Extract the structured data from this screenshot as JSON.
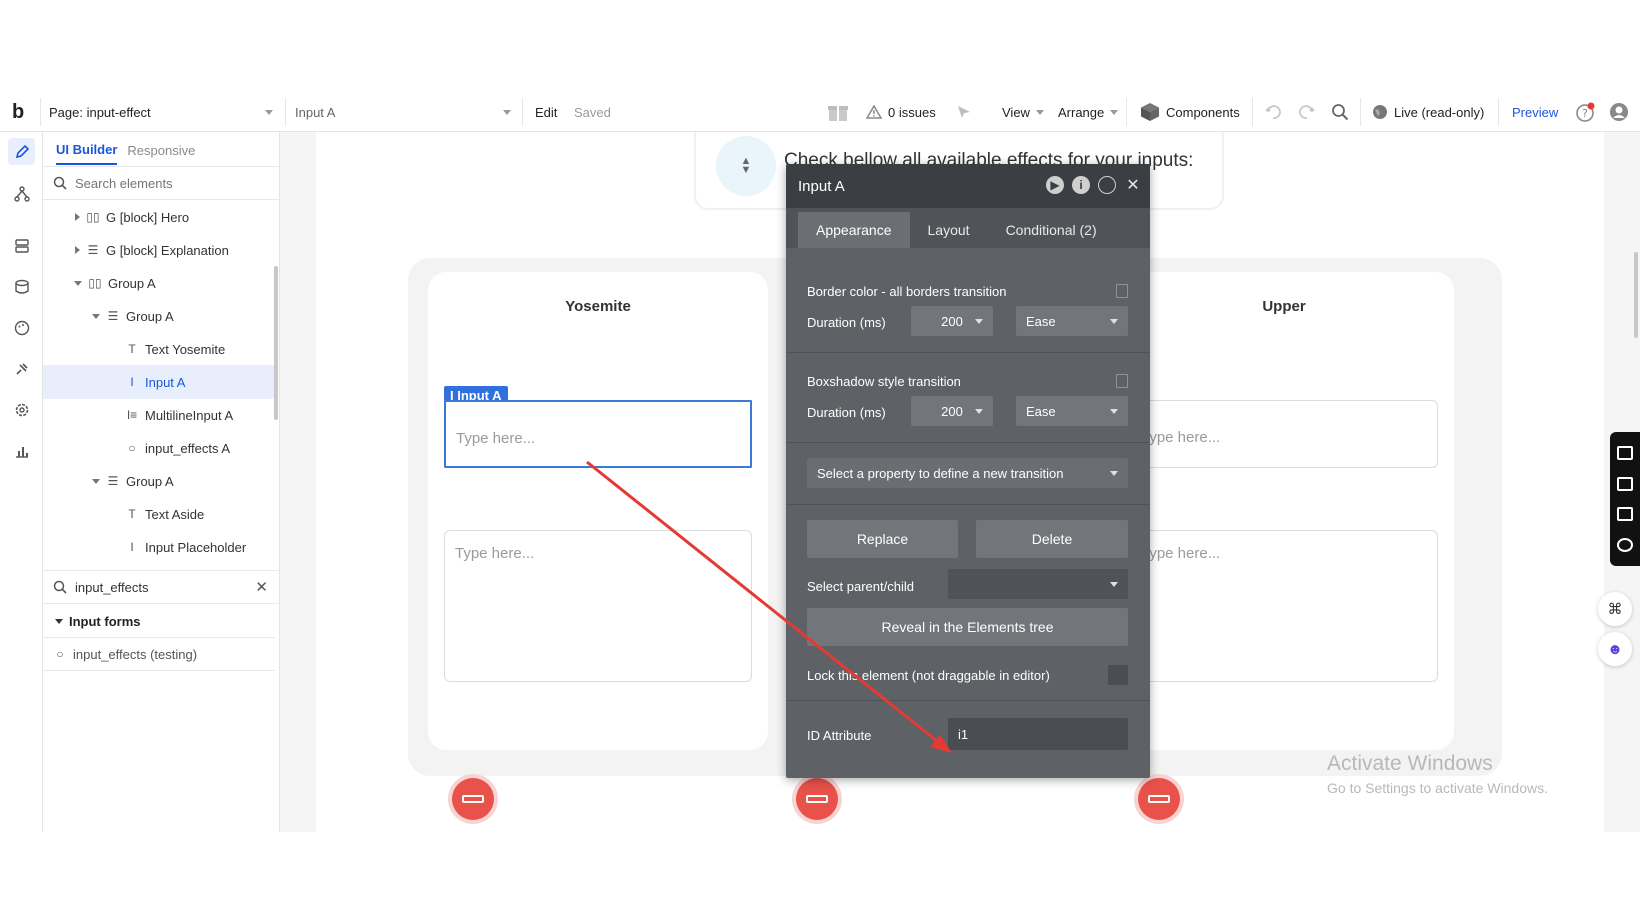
{
  "topbar": {
    "logo": "b",
    "page_label": "Page: input-effect",
    "element_selector": "Input A",
    "edit": "Edit",
    "saved": "Saved",
    "issues": "0 issues",
    "view": "View",
    "arrange": "Arrange",
    "components": "Components",
    "live": "Live (read-only)",
    "preview": "Preview"
  },
  "panel": {
    "tab_ui_builder": "UI Builder",
    "tab_responsive": "Responsive",
    "search_placeholder": "Search elements",
    "tree": [
      {
        "label": "G [block] Hero"
      },
      {
        "label": "G [block] Explanation"
      },
      {
        "label": "Group A"
      },
      {
        "label": "Group A"
      },
      {
        "label": "Text Yosemite"
      },
      {
        "label": "Input A"
      },
      {
        "label": "MultilineInput A"
      },
      {
        "label": "input_effects A"
      },
      {
        "label": "Group A"
      },
      {
        "label": "Text Aside"
      },
      {
        "label": "Input Placeholder"
      }
    ],
    "search2_value": "input_effects",
    "section_title": "Input forms",
    "section_item": "input_effects (testing)"
  },
  "canvas": {
    "top_text": "Check bellow all available effects for your inputs:",
    "col1_title": "Yosemite",
    "col3_title": "Upper",
    "selected_label": "Input A",
    "placeholder": "Type here...",
    "watermark_title": "Activate Windows",
    "watermark_sub": "Go to Settings to activate Windows."
  },
  "editor": {
    "title": "Input A",
    "tabs": [
      "Appearance",
      "Layout",
      "Conditional (2)"
    ],
    "border_transition_label": "Border color - all borders transition",
    "duration_label": "Duration (ms)",
    "border_duration": "200",
    "border_easing": "Ease",
    "boxshadow_transition_label": "Boxshadow style transition",
    "boxshadow_duration": "200",
    "boxshadow_easing": "Ease",
    "new_transition": "Select a property to define a new transition",
    "replace": "Replace",
    "delete": "Delete",
    "select_parent": "Select parent/child",
    "reveal": "Reveal in the Elements tree",
    "lock": "Lock this element (not draggable in editor)",
    "id_attribute_label": "ID Attribute",
    "id_attribute_value": "i1"
  },
  "colors": {
    "accent": "#1a56db",
    "editor_bg": "#5e6266",
    "editor_header": "#3b3e42",
    "annotation_arrow": "#e53935",
    "red_button": "#e8524a"
  }
}
